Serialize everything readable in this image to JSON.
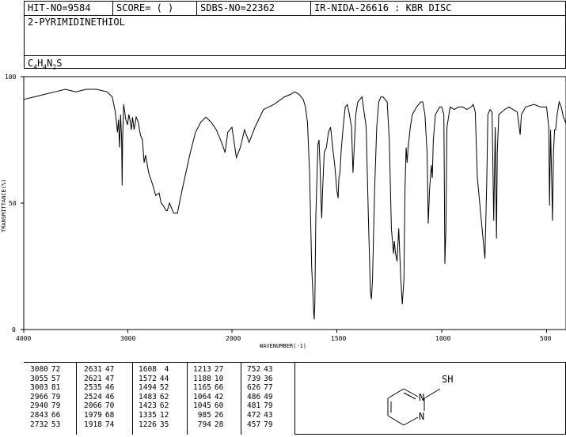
{
  "header": {
    "hit_no": "HIT-NO=9584",
    "score": "SCORE=  (   )",
    "sdbs_no": "SDBS-NO=22362",
    "ir_nida": "IR-NIDA-26616 : KBR DISC"
  },
  "compound": {
    "name": "2-PYRIMIDINETHIOL",
    "formula_parts": [
      "C",
      "4",
      "H",
      "4",
      "N",
      "2",
      "S"
    ],
    "structure_label": "SH",
    "ring_n1": "N",
    "ring_n2": "N"
  },
  "chart_data": {
    "type": "line",
    "xlabel": "WAVENUMBER(-1)",
    "ylabel": "TRANSMITTANCE(%)",
    "xlim": [
      4000,
      400
    ],
    "ylim": [
      0,
      100
    ],
    "x_ticks": [
      "4000",
      "3000",
      "2000",
      "1500",
      "1000",
      "500"
    ],
    "y_ticks": [
      "100",
      "50",
      "0"
    ],
    "grid": false,
    "series": [
      {
        "color": "#000000",
        "points": [
          [
            4000,
            91
          ],
          [
            3900,
            92
          ],
          [
            3800,
            93
          ],
          [
            3700,
            94
          ],
          [
            3600,
            95
          ],
          [
            3500,
            94
          ],
          [
            3400,
            95
          ],
          [
            3300,
            95
          ],
          [
            3200,
            94
          ],
          [
            3150,
            92
          ],
          [
            3120,
            86
          ],
          [
            3100,
            78
          ],
          [
            3090,
            83
          ],
          [
            3080,
            72
          ],
          [
            3070,
            85
          ],
          [
            3060,
            76
          ],
          [
            3055,
            57
          ],
          [
            3050,
            75
          ],
          [
            3040,
            89
          ],
          [
            3030,
            86
          ],
          [
            3020,
            83
          ],
          [
            3003,
            81
          ],
          [
            2990,
            85
          ],
          [
            2980,
            83
          ],
          [
            2966,
            79
          ],
          [
            2955,
            84
          ],
          [
            2940,
            79
          ],
          [
            2920,
            84
          ],
          [
            2900,
            82
          ],
          [
            2880,
            77
          ],
          [
            2860,
            75
          ],
          [
            2843,
            66
          ],
          [
            2830,
            69
          ],
          [
            2800,
            62
          ],
          [
            2760,
            57
          ],
          [
            2732,
            53
          ],
          [
            2700,
            54
          ],
          [
            2680,
            50
          ],
          [
            2660,
            49
          ],
          [
            2631,
            47
          ],
          [
            2621,
            47
          ],
          [
            2600,
            50
          ],
          [
            2560,
            46
          ],
          [
            2535,
            46
          ],
          [
            2524,
            46
          ],
          [
            2480,
            55
          ],
          [
            2400,
            70
          ],
          [
            2350,
            78
          ],
          [
            2300,
            82
          ],
          [
            2250,
            84
          ],
          [
            2200,
            82
          ],
          [
            2150,
            79
          ],
          [
            2100,
            74
          ],
          [
            2066,
            70
          ],
          [
            2040,
            78
          ],
          [
            2000,
            80
          ],
          [
            1979,
            68
          ],
          [
            1960,
            72
          ],
          [
            1940,
            79
          ],
          [
            1918,
            74
          ],
          [
            1890,
            80
          ],
          [
            1850,
            87
          ],
          [
            1800,
            89
          ],
          [
            1750,
            92
          ],
          [
            1720,
            93
          ],
          [
            1700,
            94
          ],
          [
            1680,
            93
          ],
          [
            1660,
            91
          ],
          [
            1650,
            88
          ],
          [
            1640,
            82
          ],
          [
            1630,
            62
          ],
          [
            1620,
            25
          ],
          [
            1610,
            6
          ],
          [
            1608,
            4
          ],
          [
            1605,
            10
          ],
          [
            1600,
            45
          ],
          [
            1590,
            73
          ],
          [
            1585,
            75
          ],
          [
            1580,
            65
          ],
          [
            1575,
            50
          ],
          [
            1572,
            44
          ],
          [
            1568,
            55
          ],
          [
            1560,
            70
          ],
          [
            1550,
            72
          ],
          [
            1540,
            78
          ],
          [
            1530,
            80
          ],
          [
            1520,
            72
          ],
          [
            1510,
            65
          ],
          [
            1500,
            55
          ],
          [
            1494,
            52
          ],
          [
            1490,
            60
          ],
          [
            1485,
            62
          ],
          [
            1480,
            70
          ],
          [
            1470,
            80
          ],
          [
            1460,
            88
          ],
          [
            1450,
            89
          ],
          [
            1440,
            85
          ],
          [
            1430,
            80
          ],
          [
            1423,
            62
          ],
          [
            1418,
            70
          ],
          [
            1410,
            85
          ],
          [
            1400,
            90
          ],
          [
            1380,
            92
          ],
          [
            1360,
            80
          ],
          [
            1350,
            45
          ],
          [
            1340,
            15
          ],
          [
            1335,
            12
          ],
          [
            1330,
            20
          ],
          [
            1320,
            55
          ],
          [
            1310,
            80
          ],
          [
            1300,
            90
          ],
          [
            1290,
            92
          ],
          [
            1280,
            92
          ],
          [
            1260,
            90
          ],
          [
            1250,
            75
          ],
          [
            1240,
            40
          ],
          [
            1230,
            30
          ],
          [
            1226,
            35
          ],
          [
            1220,
            30
          ],
          [
            1213,
            27
          ],
          [
            1205,
            40
          ],
          [
            1195,
            20
          ],
          [
            1188,
            10
          ],
          [
            1180,
            20
          ],
          [
            1175,
            55
          ],
          [
            1170,
            72
          ],
          [
            1165,
            66
          ],
          [
            1160,
            72
          ],
          [
            1150,
            80
          ],
          [
            1140,
            85
          ],
          [
            1120,
            88
          ],
          [
            1100,
            90
          ],
          [
            1090,
            90
          ],
          [
            1080,
            85
          ],
          [
            1070,
            70
          ],
          [
            1064,
            42
          ],
          [
            1058,
            55
          ],
          [
            1050,
            65
          ],
          [
            1045,
            60
          ],
          [
            1040,
            75
          ],
          [
            1030,
            85
          ],
          [
            1010,
            88
          ],
          [
            1000,
            88
          ],
          [
            990,
            85
          ],
          [
            985,
            26
          ],
          [
            980,
            40
          ],
          [
            975,
            80
          ],
          [
            960,
            88
          ],
          [
            940,
            87
          ],
          [
            920,
            88
          ],
          [
            900,
            88
          ],
          [
            880,
            87
          ],
          [
            860,
            88
          ],
          [
            850,
            89
          ],
          [
            840,
            86
          ],
          [
            830,
            60
          ],
          [
            794,
            28
          ],
          [
            785,
            60
          ],
          [
            780,
            85
          ],
          [
            770,
            87
          ],
          [
            760,
            86
          ],
          [
            752,
            43
          ],
          [
            745,
            80
          ],
          [
            739,
            36
          ],
          [
            735,
            70
          ],
          [
            728,
            85
          ],
          [
            700,
            87
          ],
          [
            680,
            88
          ],
          [
            660,
            87
          ],
          [
            640,
            86
          ],
          [
            626,
            77
          ],
          [
            620,
            85
          ],
          [
            600,
            88
          ],
          [
            560,
            89
          ],
          [
            530,
            88
          ],
          [
            500,
            88
          ],
          [
            490,
            80
          ],
          [
            486,
            49
          ],
          [
            481,
            79
          ],
          [
            476,
            60
          ],
          [
            472,
            43
          ],
          [
            467,
            70
          ],
          [
            462,
            79
          ],
          [
            457,
            79
          ],
          [
            450,
            85
          ],
          [
            440,
            90
          ],
          [
            430,
            88
          ],
          [
            420,
            84
          ],
          [
            410,
            82
          ],
          [
            400,
            80
          ]
        ]
      }
    ],
    "peak_table": [
      [
        [
          "3080",
          "72"
        ],
        [
          "3055",
          "57"
        ],
        [
          "3003",
          "81"
        ],
        [
          "2966",
          "79"
        ],
        [
          "2940",
          "79"
        ],
        [
          "2843",
          "66"
        ],
        [
          "2732",
          "53"
        ]
      ],
      [
        [
          "2631",
          "47"
        ],
        [
          "2621",
          "47"
        ],
        [
          "2535",
          "46"
        ],
        [
          "2524",
          "46"
        ],
        [
          "2066",
          "70"
        ],
        [
          "1979",
          "68"
        ],
        [
          "1918",
          "74"
        ]
      ],
      [
        [
          "1608",
          "4"
        ],
        [
          "1572",
          "44"
        ],
        [
          "1494",
          "52"
        ],
        [
          "1483",
          "62"
        ],
        [
          "1423",
          "62"
        ],
        [
          "1335",
          "12"
        ],
        [
          "1226",
          "35"
        ]
      ],
      [
        [
          "1213",
          "27"
        ],
        [
          "1188",
          "10"
        ],
        [
          "1165",
          "66"
        ],
        [
          "1064",
          "42"
        ],
        [
          "1045",
          "60"
        ],
        [
          "985",
          "26"
        ],
        [
          "794",
          "28"
        ]
      ],
      [
        [
          "752",
          "43"
        ],
        [
          "739",
          "36"
        ],
        [
          "626",
          "77"
        ],
        [
          "486",
          "49"
        ],
        [
          "481",
          "79"
        ],
        [
          "472",
          "43"
        ],
        [
          "457",
          "79"
        ]
      ]
    ]
  }
}
